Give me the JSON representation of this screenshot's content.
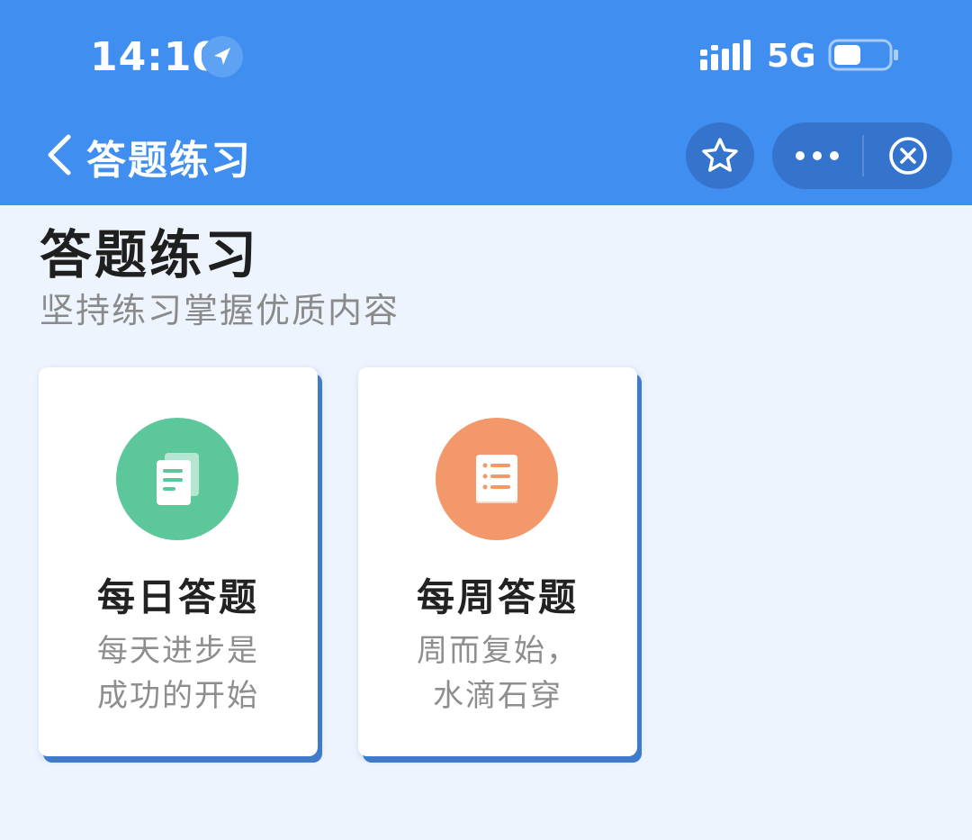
{
  "status_bar": {
    "time": "14:10",
    "network": "5G",
    "location_icon": "location-arrow-icon",
    "signal_icon": "signal-bars-icon",
    "battery_icon": "battery-icon",
    "battery_level": 0.5
  },
  "nav": {
    "title": "答题练习",
    "back_icon": "chevron-left-icon",
    "favorite_icon": "star-icon",
    "more_icon": "more-dots-icon",
    "close_icon": "close-circle-icon"
  },
  "page": {
    "title": "答题练习",
    "subtitle": "坚持练习掌握优质内容"
  },
  "cards": [
    {
      "title": "每日答题",
      "desc_line1": "每天进步是",
      "desc_line2": "成功的开始",
      "icon": "document-icon",
      "color": "#5cc79b"
    },
    {
      "title": "每周答题",
      "desc_line1": "周而复始，",
      "desc_line2": "水滴石穿",
      "icon": "book-list-icon",
      "color": "#f2986a"
    }
  ],
  "colors": {
    "header_bg": "#3f8ef0",
    "button_bg": "#3474cc",
    "page_bg": "#eef4fd",
    "card_shadow": "#3f7bc9"
  }
}
